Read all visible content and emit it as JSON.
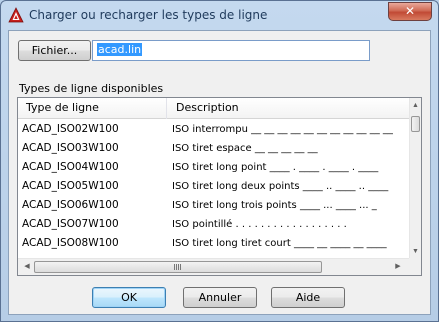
{
  "window": {
    "title": "Charger ou recharger les types de ligne",
    "close_label": "✕",
    "icon": "autocad-icon"
  },
  "file": {
    "button_label": "Fichier...",
    "value": "acad.lin"
  },
  "list": {
    "group_label": "Types de ligne disponibles",
    "columns": [
      "Type de ligne",
      "Description"
    ],
    "rows": [
      {
        "name": "ACAD_ISO02W100",
        "description": "ISO interrompu __ __ __ __ __ __ __ __ __ __ __"
      },
      {
        "name": "ACAD_ISO03W100",
        "description": "ISO tiret espace __    __    __    __    __"
      },
      {
        "name": "ACAD_ISO04W100",
        "description": "ISO tiret long point ____ . ____ . ____ . ____"
      },
      {
        "name": "ACAD_ISO05W100",
        "description": "ISO tiret long deux points ____ .. ____ .. ____"
      },
      {
        "name": "ACAD_ISO06W100",
        "description": "ISO tiret long trois points ____ ... ____ ... _"
      },
      {
        "name": "ACAD_ISO07W100",
        "description": "ISO pointillé . . . . . . . . . . . . . . . . . ."
      },
      {
        "name": "ACAD_ISO08W100",
        "description": "ISO tiret long tiret court ____ __ ____ __ ____"
      }
    ]
  },
  "buttons": {
    "ok": "OK",
    "cancel": "Annuler",
    "help": "Aide"
  },
  "colors": {
    "title_text": "#1e395b",
    "selection": "#3399ff",
    "close_button": "#c14a35"
  }
}
